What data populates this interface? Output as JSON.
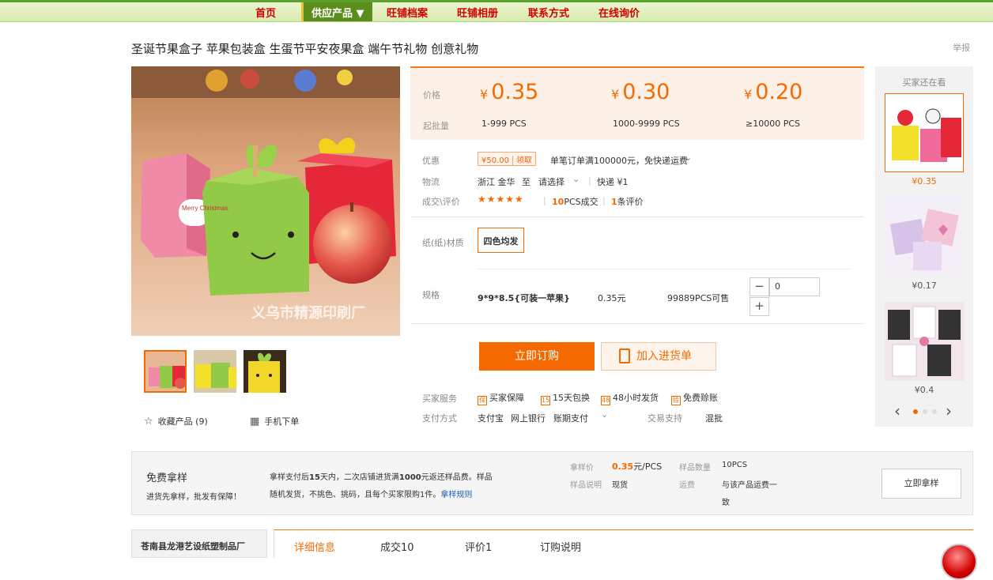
{
  "nav": {
    "items": [
      "首页",
      "供应产品 ▼",
      "旺铺档案",
      "旺铺相册",
      "联系方式",
      "在线询价"
    ]
  },
  "product": {
    "title": "圣诞节果盒子 苹果包装盒 生蛋节平安夜果盒 端午节礼物 创意礼物",
    "report": "举报",
    "image_watermark": "义乌市精源印刷厂",
    "image_box_text": "Merry Christmas"
  },
  "actions": {
    "favorite": "收藏产品 (9)",
    "mobile": "手机下单"
  },
  "pricing": {
    "price_label": "价格",
    "batch_label": "起批量",
    "currency": "¥",
    "tiers": [
      {
        "price": "0.35",
        "range": "1-999 PCS"
      },
      {
        "price": "0.30",
        "range": "1000-9999 PCS"
      },
      {
        "price": "0.20",
        "range": "≥10000 PCS"
      }
    ]
  },
  "details": {
    "discount_label": "优惠",
    "coupon_amount": "¥50.00",
    "coupon_get": "领取",
    "discount_text": "单笔订单满100000元，免快递运费",
    "logistics_label": "物流",
    "origin": "浙江 金华",
    "to": "至",
    "choose": "请选择",
    "express": "快递 ¥1",
    "deal_label": "成交\\评价",
    "stars": "★★★★★",
    "deal_count": "10",
    "deal_unit": "PCS成交",
    "review_count": "1",
    "review_unit": "条评价",
    "material_label": "纸(纸)材质",
    "material_option": "四色均发",
    "spec_label": "规格",
    "spec_name": "9*9*8.5{可装一苹果}",
    "spec_price": "0.35元",
    "spec_stock": "99889PCS可售",
    "qty_value": "0",
    "minus": "−",
    "plus": "+"
  },
  "buttons": {
    "buy": "立即订购",
    "cart": "加入进货单"
  },
  "service": {
    "buyer_label": "买家服务",
    "items": [
      "买家保障",
      "15天包换",
      "48小时发货",
      "免费赊账"
    ],
    "icons": [
      "保",
      "15",
      "48",
      "赊"
    ],
    "pay_label": "支付方式",
    "pay_items": [
      "支付宝",
      "网上银行",
      "账期支付"
    ],
    "trade_label": "交易支持",
    "trade_value": "混批"
  },
  "sidebar": {
    "title": "买家还在看",
    "items": [
      {
        "price": "¥0.35"
      },
      {
        "price": "¥0.17"
      },
      {
        "price": "¥0.4"
      }
    ],
    "prev": "‹",
    "next": "›"
  },
  "sample": {
    "title": "免费拿样",
    "subtitle": "进货先拿样，批发有保障！",
    "desc_1a": "拿样支付后",
    "desc_1b": "15",
    "desc_1c": "天内，二次店铺进货满",
    "desc_1d": "1000",
    "desc_1e": "元返还样品费。样品",
    "desc_2": "随机发货，不挑色、挑码，且每个买家限购1件。",
    "rule_link": "拿样规则",
    "price_label": "拿样价",
    "price_value": "0.35",
    "price_unit": "元/PCS",
    "count_label": "样品数量",
    "count_value": "10PCS",
    "note_label": "样品说明",
    "note_value": "现货",
    "ship_label": "运费",
    "ship_value_1": "与该产品运费一",
    "ship_value_2": "致",
    "button": "立即拿样"
  },
  "footer": {
    "company": "苍南县龙港艺设纸塑制品厂",
    "tabs": [
      "详细信息",
      "成交10",
      "评价1",
      "订购说明"
    ]
  }
}
